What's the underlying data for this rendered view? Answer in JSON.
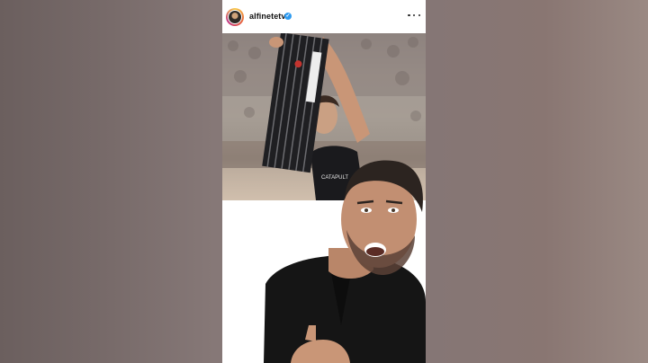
{
  "post": {
    "username": "alfinetetv",
    "verified": true
  },
  "icons": {
    "avatar": "avatar",
    "verified": "verified-badge-icon",
    "more": "more-options-icon"
  },
  "colors": {
    "verified_badge": "#2f9bf0",
    "background_left": "#6b5f5e",
    "background_right": "#9a8983",
    "jersey": "#1f1f22",
    "shirt": "#151515"
  }
}
